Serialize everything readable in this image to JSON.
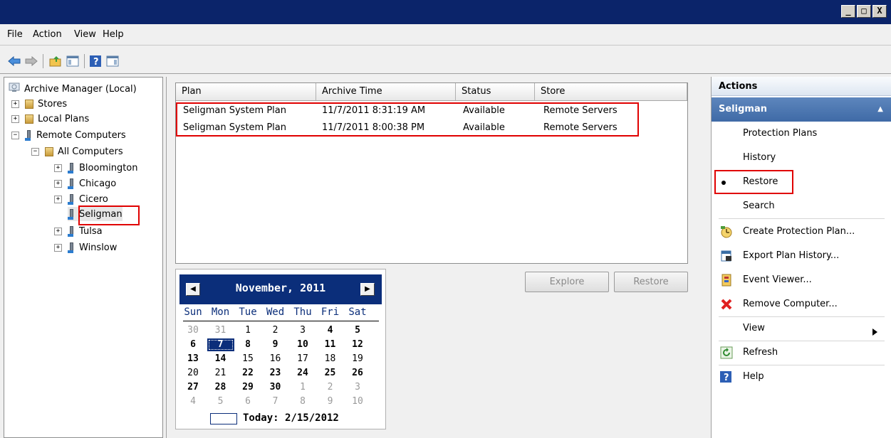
{
  "window": {
    "controls": [
      "_",
      "□",
      "X"
    ]
  },
  "menu": [
    "File",
    "Action",
    "View",
    "Help"
  ],
  "toolbar_icons": [
    "back-arrow-icon",
    "forward-arrow-icon",
    "up-folder-icon",
    "show-hide-console-tree-icon",
    "help-icon",
    "show-hide-action-pane-icon"
  ],
  "tree": {
    "root": "Archive Manager (Local)",
    "items": [
      {
        "label": "Stores",
        "expander": "+"
      },
      {
        "label": "Local Plans",
        "expander": "+"
      },
      {
        "label": "Remote Computers",
        "expander": "−"
      },
      {
        "label": "All Computers",
        "expander": "−"
      },
      {
        "label": "Bloomington",
        "expander": "+"
      },
      {
        "label": "Chicago",
        "expander": "+"
      },
      {
        "label": "Cicero",
        "expander": "+"
      },
      {
        "label": "Seligman",
        "expander": ""
      },
      {
        "label": "Tulsa",
        "expander": "+"
      },
      {
        "label": "Winslow",
        "expander": "+"
      }
    ]
  },
  "list": {
    "columns": [
      "Plan",
      "Archive Time",
      "Status",
      "Store"
    ],
    "rows": [
      {
        "plan": "Seligman System Plan",
        "time": "11/7/2011 8:31:19 AM",
        "status": "Available",
        "store": "Remote Servers"
      },
      {
        "plan": "Seligman System Plan",
        "time": "11/7/2011 8:00:38 PM",
        "status": "Available",
        "store": "Remote Servers"
      }
    ]
  },
  "calendar": {
    "title": "November, 2011",
    "prev": "◀",
    "next": "▶",
    "days_of_week": [
      "Sun",
      "Mon",
      "Tue",
      "Wed",
      "Thu",
      "Fri",
      "Sat"
    ],
    "weeks": [
      [
        "30",
        "31",
        "1",
        "2",
        "3",
        "4",
        "5"
      ],
      [
        "6",
        "7",
        "8",
        "9",
        "10",
        "11",
        "12"
      ],
      [
        "13",
        "14",
        "15",
        "16",
        "17",
        "18",
        "19"
      ],
      [
        "20",
        "21",
        "22",
        "23",
        "24",
        "25",
        "26"
      ],
      [
        "27",
        "28",
        "29",
        "30",
        "1",
        "2",
        "3"
      ],
      [
        "4",
        "5",
        "6",
        "7",
        "8",
        "9",
        "10"
      ]
    ],
    "selected": "7",
    "today_label": "Today: 2/15/2012"
  },
  "buttons": {
    "explore": "Explore",
    "restore": "Restore"
  },
  "actions": {
    "header": "Actions",
    "section": "Seligman",
    "section_chevron": "▲",
    "items": [
      {
        "label": "Protection Plans",
        "icon": ""
      },
      {
        "label": "History",
        "icon": ""
      },
      {
        "label": "Restore",
        "icon": "bullet-icon"
      },
      {
        "label": "Search",
        "icon": ""
      },
      {
        "label": "Create Protection Plan...",
        "icon": "create-plan-icon"
      },
      {
        "label": "Export Plan History...",
        "icon": "export-history-icon"
      },
      {
        "label": "Event Viewer...",
        "icon": "event-viewer-icon"
      },
      {
        "label": "Remove Computer...",
        "icon": "remove-icon"
      },
      {
        "label": "View",
        "icon": "submenu-arrow-icon"
      },
      {
        "label": "Refresh",
        "icon": "refresh-icon"
      },
      {
        "label": "Help",
        "icon": "help-icon"
      }
    ]
  },
  "colors": {
    "titlebar": "#0b246a",
    "highlight": "#e00000",
    "action_section": "#4a75b0"
  }
}
